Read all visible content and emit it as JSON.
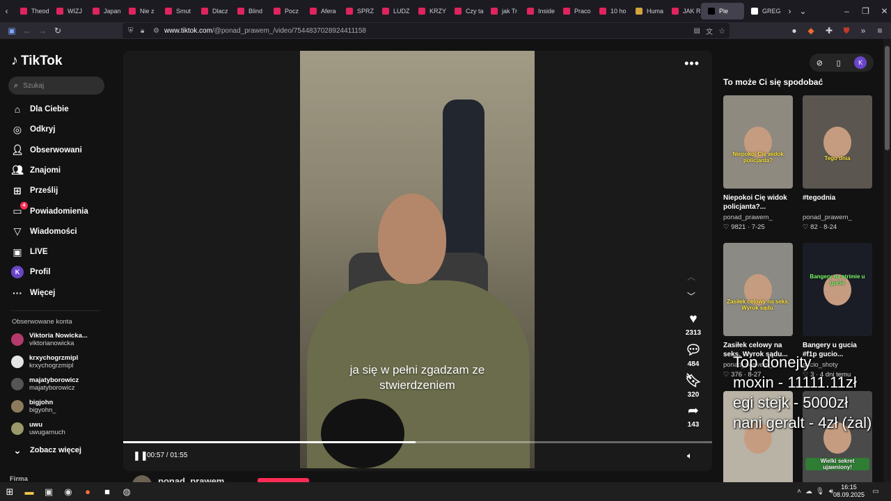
{
  "browser": {
    "tabs": [
      {
        "label": "Theod"
      },
      {
        "label": "WIZJ"
      },
      {
        "label": "Japan"
      },
      {
        "label": "Nie z"
      },
      {
        "label": "Smut"
      },
      {
        "label": "Dlacz"
      },
      {
        "label": "Blind"
      },
      {
        "label": "Pocz"
      },
      {
        "label": "Afera"
      },
      {
        "label": "SPRZ"
      },
      {
        "label": "LUDZ"
      },
      {
        "label": "KRZY"
      },
      {
        "label": "Czy ta"
      },
      {
        "label": "jak Tr"
      },
      {
        "label": "Inside"
      },
      {
        "label": "Praco"
      },
      {
        "label": "10 ho"
      },
      {
        "label": "Huma"
      },
      {
        "label": "JAK R"
      },
      {
        "label": "Pie"
      },
      {
        "label": "GREG"
      }
    ],
    "url_domain": "www.tiktok.com",
    "url_path": "/@ponad_prawem_/video/7544837028924411158"
  },
  "sidebar": {
    "logo": "TikTok",
    "search_placeholder": "Szukaj",
    "nav": [
      {
        "label": "Dla Ciebie",
        "icon": "home-icon"
      },
      {
        "label": "Odkryj",
        "icon": "compass-icon"
      },
      {
        "label": "Obserwowani",
        "icon": "following-icon"
      },
      {
        "label": "Znajomi",
        "icon": "friends-icon"
      },
      {
        "label": "Prześlij",
        "icon": "upload-icon"
      },
      {
        "label": "Powiadomienia",
        "icon": "bell-icon",
        "badge": "4"
      },
      {
        "label": "Wiadomości",
        "icon": "message-icon"
      },
      {
        "label": "LIVE",
        "icon": "live-icon"
      },
      {
        "label": "Profil",
        "icon": "avatar-k-icon",
        "avatar_letter": "K"
      },
      {
        "label": "Więcej",
        "icon": "more-icon"
      }
    ],
    "followed_title": "Obserwowane konta",
    "followed": [
      {
        "name": "Viktoria Nowicka...",
        "handle": "viktorianowicka"
      },
      {
        "name": "krxychogrzmipl",
        "handle": "krxychogrzmipl"
      },
      {
        "name": "majatyborowicz",
        "handle": "majatyborowicz"
      },
      {
        "name": "bigjohn",
        "handle": "bigyohn_"
      },
      {
        "name": "uwu",
        "handle": "uwugarnuch"
      }
    ],
    "see_more": "Zobacz więcej",
    "footer": "Firma"
  },
  "video": {
    "caption_line1": "ja się w pełni zgadzam ze",
    "caption_line2": "stwierdzeniem",
    "time": "00:57 / 01:55",
    "progress": 0.496,
    "likes": "2313",
    "comments": "484",
    "saves": "320",
    "shares": "143",
    "author": "ponad_prawem_"
  },
  "right": {
    "title": "To może Ci się spodobać",
    "profile_letter": "K",
    "cards": [
      {
        "title": "Niepokoi Cię widok policjanta?...",
        "user": "ponad_prawem_",
        "stats": "♡ 9821 · 7-25",
        "thumb_text": "Niepokoi Cię widok policjanta?"
      },
      {
        "title": "#tegodnia",
        "user": "ponad_prawem_",
        "stats": "♡ 82 · 8-24",
        "thumb_text": "Tego dnia"
      },
      {
        "title": "Zasiłek celowy na seks. Wyrok sądu...",
        "user": "ponad_prawem_",
        "stats": "♡ 376 · 8-27",
        "thumb_text": "Zasiłek celowy na seks. Wyrok sądu."
      },
      {
        "title": "Bangery u gucia #f1p gucio...",
        "user": "gucio_shoty",
        "stats": "♡ 3 · 4 dni temu",
        "thumb_text": "Bangery na strimie u gucia"
      },
      {
        "title": "",
        "user": "",
        "stats": "",
        "thumb_text": ""
      },
      {
        "title": "",
        "user": "",
        "stats": "",
        "thumb_text": "Wielki sekret ujawniony!"
      }
    ]
  },
  "overlay": {
    "line1": "Top donejty",
    "line2": "moxin - 11111.11zł",
    "line3": "egi stejk - 5000zł",
    "line4": "nani geralt - 4zł (żal)"
  },
  "taskbar": {
    "time": "16:15",
    "date": "08.09.2025"
  }
}
